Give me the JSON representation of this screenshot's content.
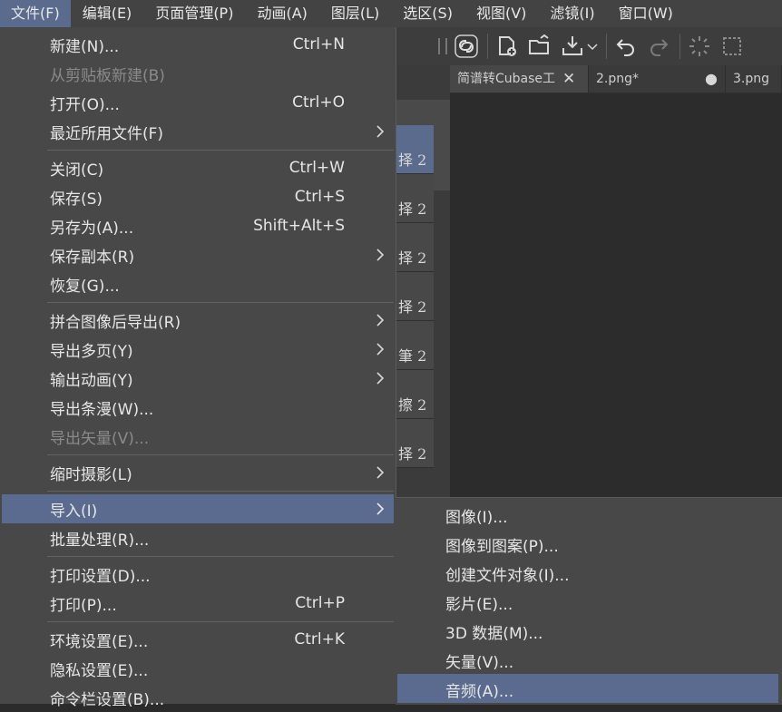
{
  "menubar": {
    "items": [
      "文件(F)",
      "编辑(E)",
      "页面管理(P)",
      "动画(A)",
      "图层(L)",
      "选区(S)",
      "视图(V)",
      "滤镜(I)",
      "窗口(W)"
    ]
  },
  "tabs": [
    {
      "label": "简谱转Cubase工",
      "has_close": true
    },
    {
      "label": "2.png*",
      "has_dot": true
    },
    {
      "label": "3.png"
    }
  ],
  "tab_close_glyph": "✕",
  "tab_dot_glyph": "●",
  "side_list": {
    "items": [
      "择 2",
      "择 2",
      "择 2",
      "择 2",
      "筆 2",
      "擦 2",
      "择 2"
    ]
  },
  "file_menu": {
    "items": [
      {
        "label": "新建(N)...",
        "shortcut": "Ctrl+N"
      },
      {
        "label": "从剪贴板新建(B)",
        "disabled": true
      },
      {
        "label": "打开(O)...",
        "shortcut": "Ctrl+O"
      },
      {
        "label": "最近所用文件(F)",
        "submenu": true
      },
      {
        "label": "关闭(C)",
        "shortcut": "Ctrl+W"
      },
      {
        "label": "保存(S)",
        "shortcut": "Ctrl+S"
      },
      {
        "label": "另存为(A)...",
        "shortcut": "Shift+Alt+S"
      },
      {
        "label": "保存副本(R)",
        "submenu": true
      },
      {
        "label": "恢复(G)..."
      },
      {
        "label": "拼合图像后导出(R)",
        "submenu": true
      },
      {
        "label": "导出多页(Y)",
        "submenu": true
      },
      {
        "label": "输出动画(Y)",
        "submenu": true
      },
      {
        "label": "导出条漫(W)..."
      },
      {
        "label": "导出矢量(V)...",
        "disabled": true
      },
      {
        "label": "缩时摄影(L)",
        "submenu": true
      },
      {
        "label": "导入(I)",
        "submenu": true,
        "highlighted": true
      },
      {
        "label": "批量处理(R)..."
      },
      {
        "label": "打印设置(D)..."
      },
      {
        "label": "打印(P)...",
        "shortcut": "Ctrl+P"
      },
      {
        "label": "环境设置(E)...",
        "shortcut": "Ctrl+K"
      },
      {
        "label": "隐私设置(E)..."
      },
      {
        "label": "命令栏设置(B)..."
      }
    ]
  },
  "import_submenu": {
    "items": [
      {
        "label": "图像(I)..."
      },
      {
        "label": "图像到图案(P)..."
      },
      {
        "label": "创建文件对象(I)..."
      },
      {
        "label": "影片(E)..."
      },
      {
        "label": "3D 数据(M)..."
      },
      {
        "label": "矢量(V)..."
      },
      {
        "label": "音频(A)...",
        "highlighted": true
      }
    ]
  },
  "toolbar_icons": [
    "link-icon",
    "new-file-icon",
    "open-folder-icon",
    "import-icon",
    "undo-icon",
    "redo-icon",
    "spinner-icon",
    "selection-icon"
  ]
}
